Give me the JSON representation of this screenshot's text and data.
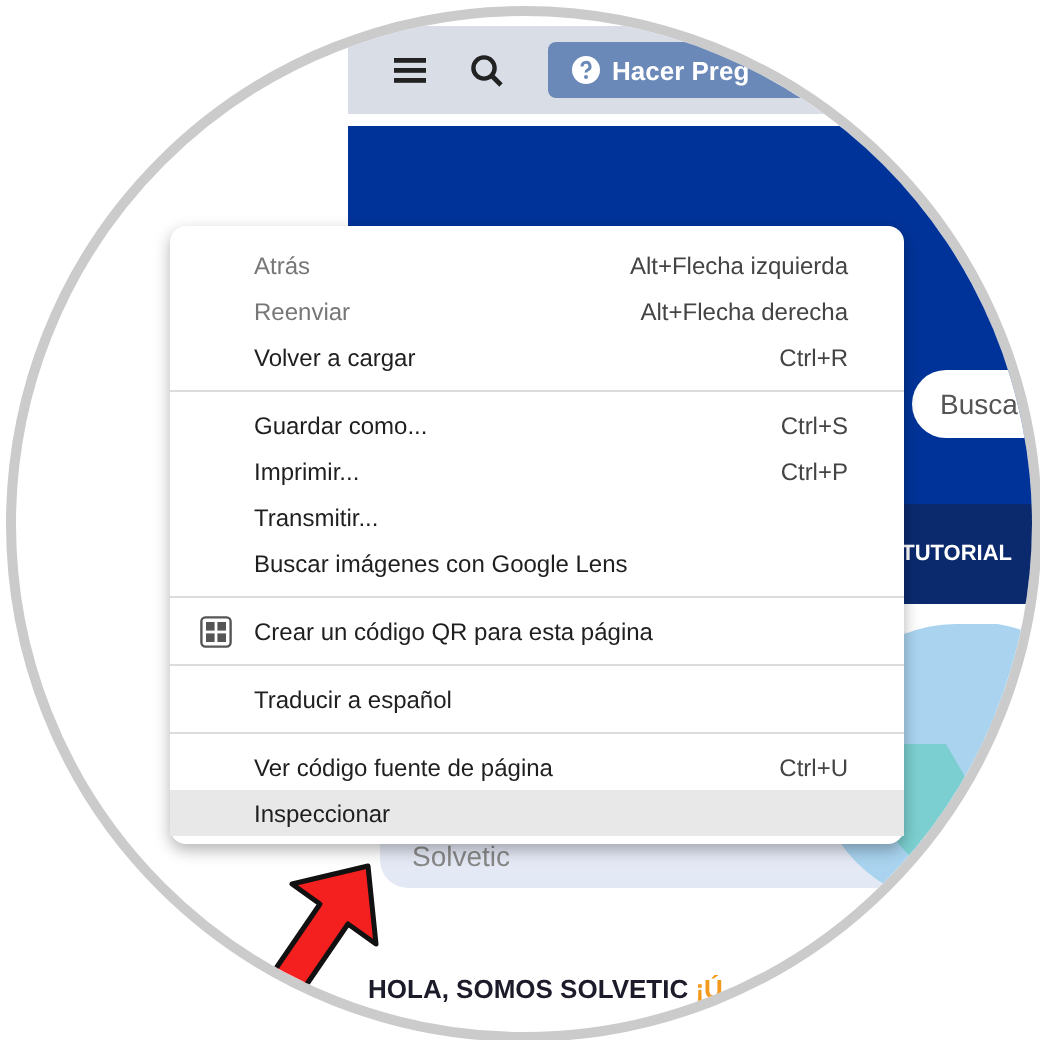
{
  "header": {
    "ask_button": "Hacer Preg"
  },
  "search": {
    "placeholder": "Busca"
  },
  "nav": {
    "item": "TUTORIAL"
  },
  "card": {
    "text": "Solvetic"
  },
  "intro": {
    "text": "HOLA, SOMOS SOLVETIC",
    "accent": "¡Ú"
  },
  "context_menu": {
    "sections": [
      [
        {
          "kind": "plain",
          "label": "Atrás",
          "shortcut": "Alt+Flecha izquierda",
          "disabled": true,
          "selected": false
        },
        {
          "kind": "plain",
          "label": "Reenviar",
          "shortcut": "Alt+Flecha derecha",
          "disabled": true,
          "selected": false
        },
        {
          "kind": "plain",
          "label": "Volver a cargar",
          "shortcut": "Ctrl+R",
          "disabled": false,
          "selected": false
        }
      ],
      [
        {
          "kind": "plain",
          "label": "Guardar como...",
          "shortcut": "Ctrl+S",
          "disabled": false,
          "selected": false
        },
        {
          "kind": "plain",
          "label": "Imprimir...",
          "shortcut": "Ctrl+P",
          "disabled": false,
          "selected": false
        },
        {
          "kind": "plain",
          "label": "Transmitir...",
          "disabled": false,
          "selected": false
        },
        {
          "kind": "plain",
          "label": "Buscar imágenes con Google Lens",
          "disabled": false,
          "selected": false
        }
      ],
      [
        {
          "kind": "qr",
          "label": "Crear un código QR para esta página",
          "disabled": false,
          "selected": false
        }
      ],
      [
        {
          "kind": "plain",
          "label": "Traducir a español",
          "disabled": false,
          "selected": false
        }
      ],
      [
        {
          "kind": "plain",
          "label": "Ver código fuente de página",
          "shortcut": "Ctrl+U",
          "disabled": false,
          "selected": false
        },
        {
          "kind": "plain",
          "label": "Inspeccionar",
          "disabled": false,
          "selected": true
        }
      ]
    ]
  }
}
